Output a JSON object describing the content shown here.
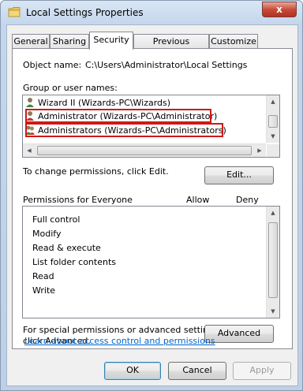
{
  "window": {
    "title": "Local Settings Properties",
    "close_label": "x"
  },
  "tabs": [
    {
      "label": "General",
      "active": false
    },
    {
      "label": "Sharing",
      "active": false
    },
    {
      "label": "Security",
      "active": true
    },
    {
      "label": "Previous Versions",
      "active": false
    },
    {
      "label": "Customize",
      "active": false
    }
  ],
  "security": {
    "object_name_label": "Object name:",
    "object_name_value": "C:\\Users\\Administrator\\Local Settings",
    "group_label": "Group or user names:",
    "groups": [
      {
        "name": "Wizard II (Wizards-PC\\Wizards)",
        "highlighted": false
      },
      {
        "name": "Administrator (Wizards-PC\\Administrator)",
        "highlighted": true
      },
      {
        "name": "Administrators (Wizards-PC\\Administrators)",
        "highlighted": true
      }
    ],
    "change_text": "To change permissions, click Edit.",
    "edit_button": "Edit...",
    "permissions_label": "Permissions for Everyone",
    "allow_header": "Allow",
    "deny_header": "Deny",
    "permissions": [
      "Full control",
      "Modify",
      "Read & execute",
      "List folder contents",
      "Read",
      "Write"
    ],
    "special_text_line1": "For special permissions or advanced settings,",
    "special_text_line2": "click Advanced.",
    "advanced_button": "Advanced",
    "learn_link": "Learn about access control and permissions"
  },
  "footer": {
    "ok": "OK",
    "cancel": "Cancel",
    "apply": "Apply"
  },
  "colors": {
    "highlight_border": "#d01818",
    "link": "#0066cc"
  }
}
